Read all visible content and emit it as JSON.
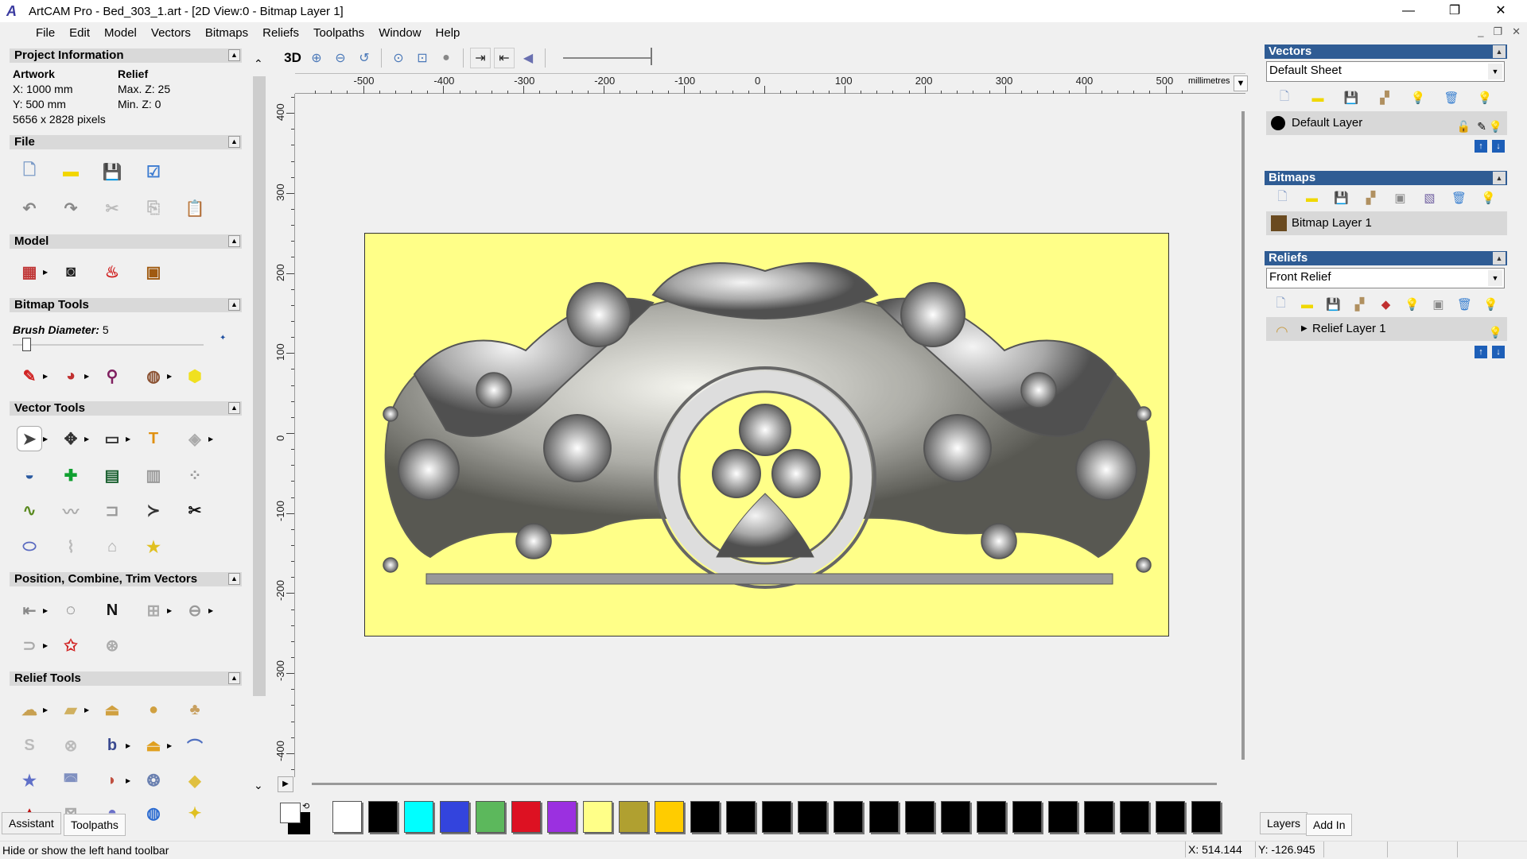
{
  "window": {
    "title": "ArtCAM Pro - Bed_303_1.art - [2D View:0 - Bitmap Layer 1]",
    "controls": [
      "—",
      "❐",
      "✕"
    ],
    "mdi_controls": [
      "_",
      "❐",
      "✕"
    ]
  },
  "menu": [
    "File",
    "Edit",
    "Model",
    "Vectors",
    "Bitmaps",
    "Reliefs",
    "Toolpaths",
    "Window",
    "Help"
  ],
  "left": {
    "project": {
      "header": "Project Information",
      "artwork_label": "Artwork",
      "relief_label": "Relief",
      "x": "X: 1000 mm",
      "y": "Y: 500 mm",
      "pixels": "5656 x 2828 pixels",
      "maxz": "Max. Z: 25",
      "minz": "Min. Z: 0"
    },
    "sections": {
      "file": "File",
      "model": "Model",
      "bitmap_tools": "Bitmap Tools",
      "vector_tools": "Vector Tools",
      "position": "Position, Combine, Trim Vectors",
      "relief_tools": "Relief Tools"
    },
    "brush_label": "Brush Diameter:",
    "brush_value": "5",
    "brush_level": 0.05,
    "tabs": [
      "Assistant",
      "Toolpaths"
    ],
    "rows": [
      [
        {
          "n": "new-file",
          "g": "🗋",
          "c": "#7d9cc8"
        },
        {
          "n": "open-folder",
          "g": "▬",
          "c": "#f2d600"
        },
        {
          "n": "save",
          "g": "💾",
          "c": "#2d66c4"
        },
        {
          "n": "setup-model",
          "g": "☑",
          "c": "#3b7bd0"
        }
      ],
      [
        {
          "n": "undo",
          "g": "↶",
          "c": "#888"
        },
        {
          "n": "redo",
          "g": "↷",
          "c": "#888"
        },
        {
          "n": "cut",
          "g": "✂",
          "c": "#bbb"
        },
        {
          "n": "copy",
          "g": "⎘",
          "c": "#bbb"
        },
        {
          "n": "paste",
          "g": "📋",
          "c": "#c84020"
        }
      ],
      [
        {
          "n": "model-size",
          "g": "▦",
          "c": "#c03838",
          "a": 1
        },
        {
          "n": "grayscale-model",
          "g": "◙",
          "c": "#222"
        },
        {
          "n": "lighting",
          "g": "♨",
          "c": "#d02020"
        },
        {
          "n": "import-image",
          "g": "▣",
          "c": "#a05a10"
        }
      ],
      [
        {
          "n": "pencil",
          "g": "✎",
          "c": "#d02020",
          "a": 1
        },
        {
          "n": "fill",
          "g": "◕",
          "c": "#c03030",
          "a": 1
        },
        {
          "n": "eyedropper",
          "g": "⚲",
          "c": "#802060"
        },
        {
          "n": "palette",
          "g": "◍",
          "c": "#8a5030",
          "a": 1
        },
        {
          "n": "bitmap-to-vector",
          "g": "⬢",
          "c": "#f0e020"
        }
      ],
      [
        {
          "n": "select",
          "g": "➤",
          "c": "#444",
          "a": 1,
          "s": 1
        },
        {
          "n": "transform",
          "g": "✥",
          "c": "#333",
          "a": 1
        },
        {
          "n": "rectangle",
          "g": "▭",
          "c": "#333",
          "a": 1
        },
        {
          "n": "text",
          "g": "T",
          "c": "#e09010"
        },
        {
          "n": "shape-editor",
          "g": "◈",
          "c": "#aaa",
          "a": 1
        }
      ],
      [
        {
          "n": "measure",
          "g": "◒",
          "c": "#2a5aa0"
        },
        {
          "n": "add-node",
          "g": "✚",
          "c": "#10a030"
        },
        {
          "n": "text-layout",
          "g": "▤",
          "c": "#1a6030"
        },
        {
          "n": "wrap",
          "g": "▥",
          "c": "#999"
        },
        {
          "n": "array",
          "g": "⁘",
          "c": "#999"
        }
      ],
      [
        {
          "n": "node-edit",
          "g": "∿",
          "c": "#5a8a20"
        },
        {
          "n": "smooth",
          "g": "〰",
          "c": "#aaa"
        },
        {
          "n": "fillet",
          "g": "⊐",
          "c": "#999"
        },
        {
          "n": "trim",
          "g": "≻",
          "c": "#333"
        },
        {
          "n": "cut-vectors",
          "g": "✂",
          "c": "#111"
        }
      ],
      [
        {
          "n": "extrude",
          "g": "⬭",
          "c": "#5a6ac0"
        },
        {
          "n": "join",
          "g": "⌇",
          "c": "#bbb"
        },
        {
          "n": "mirror",
          "g": "⌂",
          "c": "#aaa"
        },
        {
          "n": "star",
          "g": "★",
          "c": "#e0c020"
        }
      ],
      [
        {
          "n": "align",
          "g": "⇤",
          "c": "#888",
          "a": 1
        },
        {
          "n": "text-on-curve",
          "g": "◌",
          "c": "#333"
        },
        {
          "n": "nesting",
          "g": "N",
          "c": "#111"
        },
        {
          "n": "block-copy",
          "g": "⊞",
          "c": "#aaa",
          "a": 1
        },
        {
          "n": "weld",
          "g": "⊖",
          "c": "#999",
          "a": 1
        }
      ],
      [
        {
          "n": "offset",
          "g": "⊃",
          "c": "#aaa",
          "a": 1
        },
        {
          "n": "texture-star",
          "g": "✩",
          "c": "#d02020"
        },
        {
          "n": "spiral",
          "g": "⊛",
          "c": "#aaa"
        }
      ],
      [
        {
          "n": "shape-relief",
          "g": "☁",
          "c": "#c8a050",
          "a": 1
        },
        {
          "n": "extrude-relief",
          "g": "▰",
          "c": "#d0b060",
          "a": 1
        },
        {
          "n": "sculpt",
          "g": "⏏",
          "c": "#d0a040"
        },
        {
          "n": "smooth-relief",
          "g": "●",
          "c": "#d0a040"
        },
        {
          "n": "raise-relief",
          "g": "♣",
          "c": "#c8a060"
        }
      ],
      [
        {
          "n": "swept",
          "g": "S",
          "c": "#bbb"
        },
        {
          "n": "weave",
          "g": "⊗",
          "c": "#bbb"
        },
        {
          "n": "relief-from-text",
          "g": "b",
          "c": "#3a4a90",
          "a": 1
        },
        {
          "n": "offset-relief",
          "g": "⏏",
          "c": "#e0a020",
          "a": 1
        },
        {
          "n": "two-rail",
          "g": "⌒",
          "c": "#5070c0"
        }
      ],
      [
        {
          "n": "star-relief",
          "g": "★",
          "c": "#6070c8"
        },
        {
          "n": "spin",
          "g": "◚",
          "c": "#8090c0"
        },
        {
          "n": "split",
          "g": "◗",
          "c": "#c05040",
          "a": 1
        },
        {
          "n": "texture-relief",
          "g": "❂",
          "c": "#6a80b0"
        },
        {
          "n": "paste-relief",
          "g": "◆",
          "c": "#e0c040"
        }
      ],
      [
        {
          "n": "relief-red",
          "g": "▲",
          "c": "#c01010"
        },
        {
          "n": "basket",
          "g": "⊠",
          "c": "#aaa"
        },
        {
          "n": "dome",
          "g": "◓",
          "c": "#6a70c8"
        },
        {
          "n": "globe",
          "g": "◍",
          "c": "#2a6ad0"
        },
        {
          "n": "flower",
          "g": "✦",
          "c": "#e0c020"
        }
      ]
    ]
  },
  "toolbar": {
    "label_3d": "3D",
    "icons": [
      "zoom-in",
      "zoom-out",
      "zoom-previous",
      "zoom-all",
      "zoom-box",
      "zoom-fit",
      "toggle-left",
      "toggle-right",
      "pan"
    ],
    "zoom_level": 1.0
  },
  "ruler": {
    "units": "millimetres",
    "h_ticks": [
      "-500",
      "-400",
      "-300",
      "-200",
      "-100",
      "0",
      "100",
      "200",
      "300",
      "400",
      "500"
    ],
    "v_ticks": [
      "400",
      "300",
      "200",
      "100",
      "0",
      "-100",
      "-200",
      "-300",
      "-400"
    ]
  },
  "artwork": {
    "sheet_color": "#ffff88",
    "relief_color": "#9a9a9a"
  },
  "palette": {
    "colors": [
      "#ffffff",
      "#000000",
      "#00ffff",
      "#3344dd",
      "#5cb85c",
      "#dd1122",
      "#9b30e0",
      "#ffff88",
      "#b0a030",
      "#ffcc00",
      "#000000",
      "#000000",
      "#000000",
      "#000000",
      "#000000",
      "#000000",
      "#000000",
      "#000000",
      "#000000",
      "#000000",
      "#000000",
      "#000000",
      "#000000",
      "#000000",
      "#000000"
    ]
  },
  "right": {
    "vectors": {
      "header": "Vectors",
      "sheet": "Default Sheet",
      "layer": "Default Layer",
      "icons": [
        "new",
        "open",
        "save",
        "merge",
        "properties",
        "delete",
        "visibility"
      ]
    },
    "bitmaps": {
      "header": "Bitmaps",
      "layer": "Bitmap Layer 1",
      "icons": [
        "new",
        "open",
        "save",
        "merge",
        "grayscale",
        "image",
        "delete",
        "visibility"
      ]
    },
    "reliefs": {
      "header": "Reliefs",
      "relief": "Front Relief",
      "layer": "Relief Layer 1",
      "icons": [
        "new",
        "open",
        "save",
        "merge",
        "combine",
        "properties",
        "grayscale",
        "delete",
        "visibility"
      ]
    },
    "tabs": [
      "Layers",
      "Add In"
    ]
  },
  "status": {
    "message": "Hide or show the left hand toolbar",
    "x": "X: 514.144",
    "y": "Y: -126.945"
  }
}
